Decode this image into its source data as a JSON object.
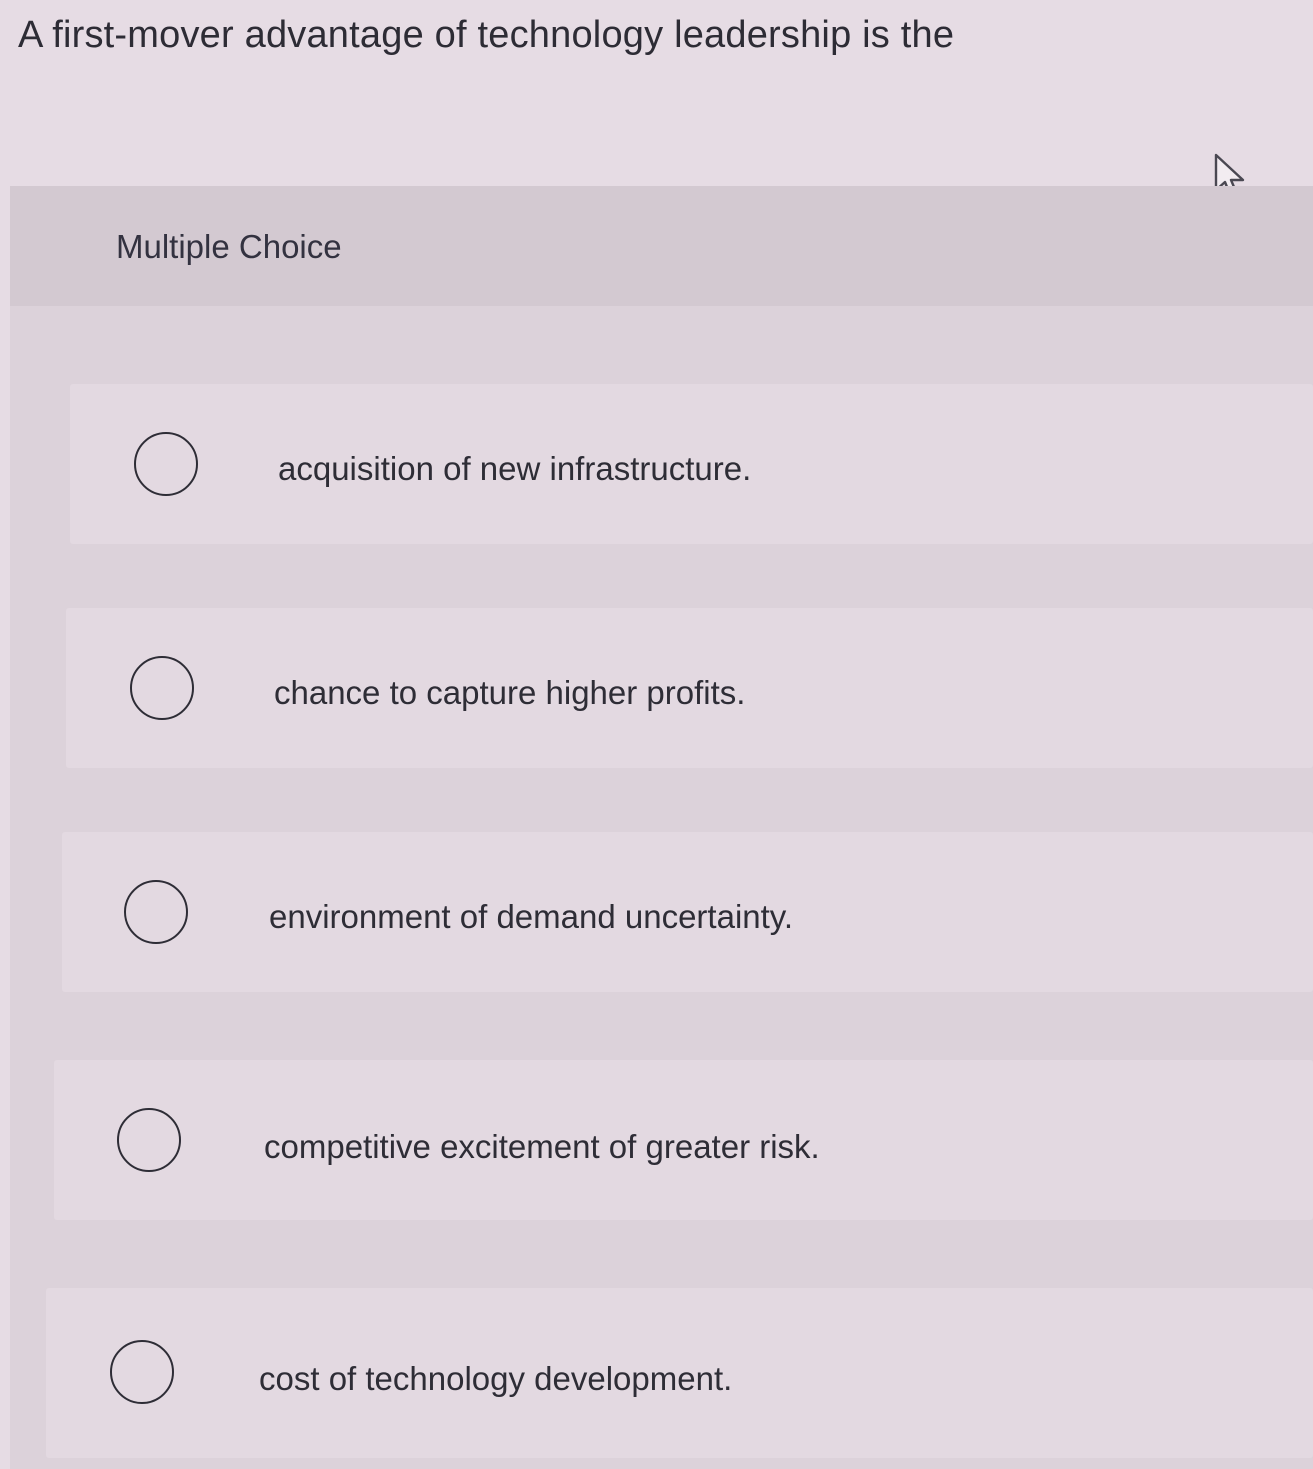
{
  "question": {
    "text": "A first-mover advantage of technology leadership is the"
  },
  "multiple_choice": {
    "label": "Multiple Choice",
    "options": [
      {
        "text": "acquisition of new infrastructure.",
        "selected": false
      },
      {
        "text": "chance to capture higher profits.",
        "selected": false
      },
      {
        "text": "environment of demand uncertainty.",
        "selected": false
      },
      {
        "text": "competitive excitement of greater risk.",
        "selected": false
      },
      {
        "text": "cost of technology development.",
        "selected": false
      }
    ]
  },
  "icons": {
    "cursor": "mouse-pointer-icon",
    "radio": "radio-unchecked-icon"
  },
  "colors": {
    "background": "#e6dce4",
    "header_band": "#d3c9d1",
    "option_card": "#e3d9e1",
    "text": "#2e2d36"
  }
}
